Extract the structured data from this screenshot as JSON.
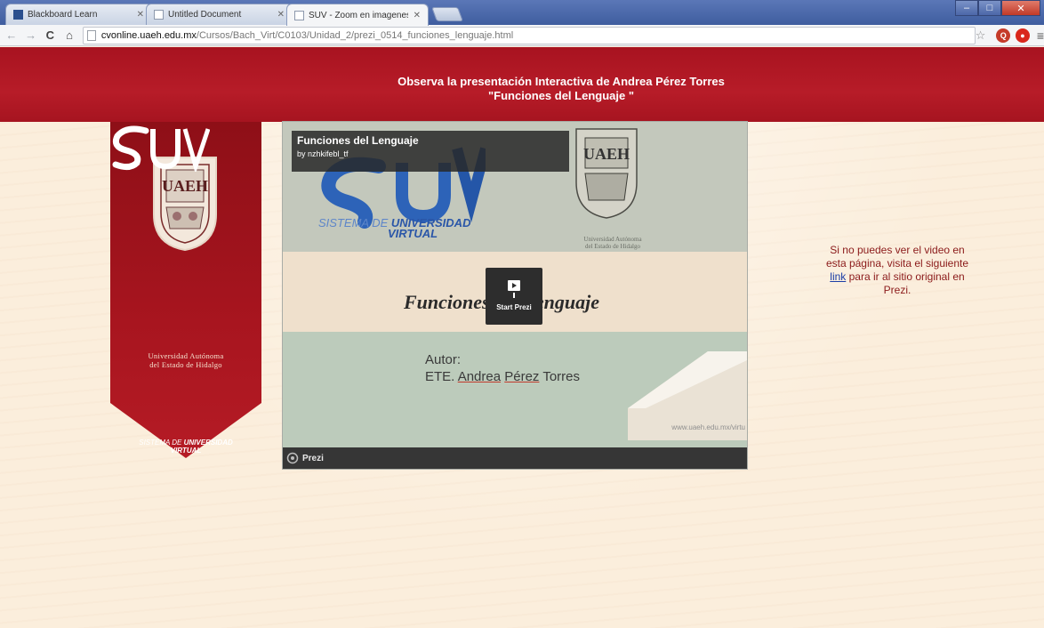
{
  "browser": {
    "tabs": [
      {
        "label": "Blackboard Learn"
      },
      {
        "label": "Untitled Document"
      },
      {
        "label": "SUV - Zoom en imagenes"
      }
    ],
    "url_host": "cvonline.uaeh.edu.mx",
    "url_path": "/Cursos/Bach_Virt/C0103/Unidad_2/prezi_0514_funciones_lenguaje.html"
  },
  "header": {
    "line1": "Observa la presentación Interactiva de Andrea Pérez Torres",
    "line2": "\"Funciones del Lenguaje \""
  },
  "banner": {
    "university_line1": "Universidad Autónoma",
    "university_line2": "del Estado de Hidalgo",
    "suv_caption_thin": "SISTEMA DE ",
    "suv_caption_bold": "UNIVERSIDAD",
    "suv_caption_bold2": "VIRTUAL"
  },
  "prezi": {
    "info_title": "Funciones del Lenguaje",
    "info_by": "by nzhkifebl_tf",
    "slide_suv_thin": "SISTEMA DE",
    "slide_suv_bold": "UNIVERSIDAD",
    "slide_suv_virtual": "VIRTUAL",
    "crest_caption_line1": "Universidad Autónoma",
    "crest_caption_line2": "del Estado de Hidalgo",
    "title": "Funciones del Lenguaje",
    "autor_label": "Autor:",
    "autor_prefix": "ETE. ",
    "autor_first": "Andrea",
    "autor_last": "Pérez",
    "autor_tail": " Torres",
    "slide_url": "www.uaeh.edu.mx/virtu",
    "start_label": "Start Prezi",
    "bar_label": "Prezi"
  },
  "note": {
    "before": "Si no puedes ver el video en esta página, visita el siguiente ",
    "link": "link",
    "after": " para ir al sitio original en Prezi."
  },
  "colors": {
    "header_red": "#b71c28",
    "banner_red": "#a3121d",
    "page_bg": "#fbeedc",
    "link_blue": "#1b3da6"
  }
}
